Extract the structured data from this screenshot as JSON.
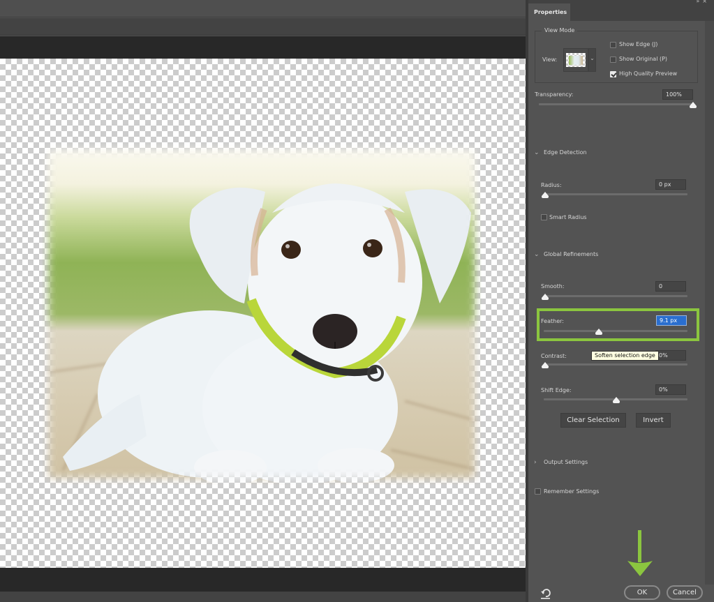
{
  "panel": {
    "tab_label": "Properties",
    "header_icons": [
      "collapse-icon",
      "close-icon"
    ],
    "view_mode": {
      "title": "View Mode",
      "view_label": "View:",
      "options": [
        {
          "label": "Show Edge (J)",
          "checked": false
        },
        {
          "label": "Show Original (P)",
          "checked": false
        },
        {
          "label": "High Quality Preview",
          "checked": true
        }
      ]
    },
    "transparency": {
      "label": "Transparency:",
      "value": "100%",
      "slider_fraction": 1.0
    },
    "edge_detection": {
      "title": "Edge Detection",
      "expanded": true,
      "radius": {
        "label": "Radius:",
        "value": "0 px",
        "slider_fraction": 0.0
      },
      "smart_radius": {
        "label": "Smart Radius",
        "checked": false
      }
    },
    "global_refinements": {
      "title": "Global Refinements",
      "expanded": true,
      "smooth": {
        "label": "Smooth:",
        "value": "0",
        "slider_fraction": 0.0
      },
      "feather": {
        "label": "Feather:",
        "value": "9.1 px",
        "slider_fraction": 0.37
      },
      "contrast": {
        "label": "Contrast:",
        "value": "0%",
        "slider_fraction": 0.0
      },
      "shift_edge": {
        "label": "Shift Edge:",
        "value": "0%",
        "slider_fraction": 0.5
      },
      "clear_selection_label": "Clear Selection",
      "invert_label": "Invert"
    },
    "output_settings": {
      "title": "Output Settings",
      "expanded": false
    },
    "remember_settings": {
      "label": "Remember Settings",
      "checked": false
    },
    "tooltip": "Soften selection edge",
    "ok_label": "OK",
    "cancel_label": "Cancel"
  },
  "annotations": {
    "highlight_color": "#8bc53f",
    "arrow_color": "#8bc53f"
  },
  "canvas": {
    "image_subject": "white puppy with lime green collar lying on wooden deck, feathered edges on transparent background"
  }
}
